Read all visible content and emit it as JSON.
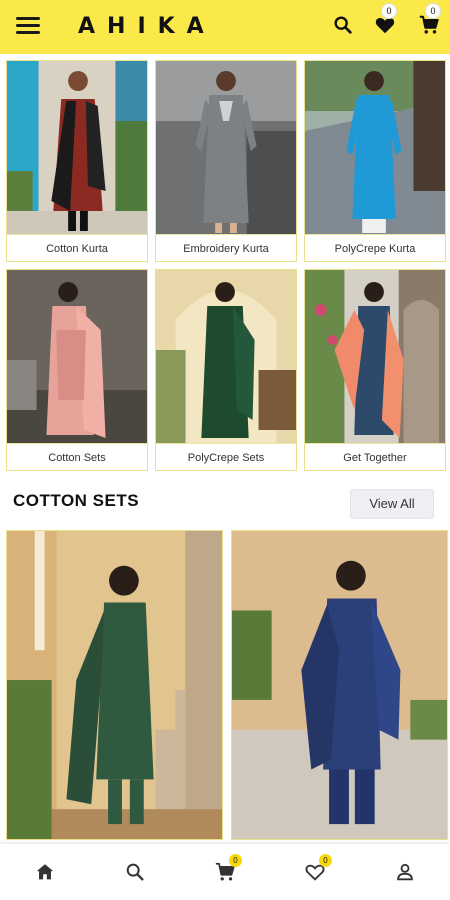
{
  "app": {
    "logo": "AHIKA",
    "brand_color": "#fbe94a"
  },
  "header": {
    "menu_icon": "hamburger-menu-icon",
    "search_icon": "search-icon",
    "wishlist_icon": "heart-icon",
    "wishlist_count": "0",
    "cart_icon": "cart-icon",
    "cart_count": "0"
  },
  "categories": [
    {
      "label": "Cotton Kurta"
    },
    {
      "label": "Embroidery Kurta"
    },
    {
      "label": "PolyCrepe Kurta"
    },
    {
      "label": "Cotton Sets"
    },
    {
      "label": "PolyCrepe Sets"
    },
    {
      "label": "Get Together"
    }
  ],
  "section": {
    "title": "COTTON SETS",
    "view_all": "View All"
  },
  "bottom_nav": {
    "home_icon": "home-icon",
    "search_icon": "search-icon",
    "cart_icon": "cart-icon",
    "cart_count": "0",
    "wishlist_icon": "heart-icon",
    "wishlist_count": "0",
    "profile_icon": "person-icon"
  }
}
